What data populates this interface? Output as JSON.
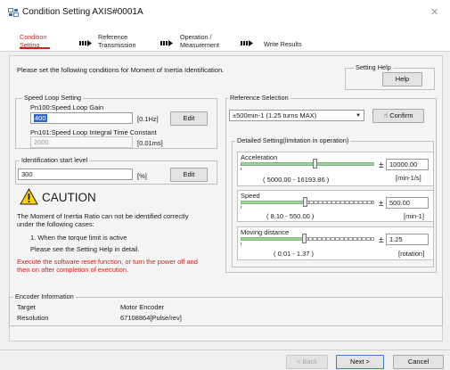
{
  "window": {
    "title": "Condition Setting AXIS#0001A",
    "icon": "app-window-icon",
    "close_icon": "close-icon"
  },
  "wizard": {
    "steps": [
      {
        "label": "Condition\nSetting",
        "active": true
      },
      {
        "label": "Reference\nTransmission",
        "active": false
      },
      {
        "label": "Operation /\nMeasurement",
        "active": false
      },
      {
        "label": "Write Results",
        "active": false
      }
    ],
    "active_color": "#d0241b"
  },
  "instructions": "Please set the following conditions for Moment of Inertia Identification.",
  "setting_help": {
    "group_label": "Setting Help",
    "button": "Help"
  },
  "speed_loop": {
    "group_label": "Speed Loop Setting",
    "gain_label": "Pn100:Speed Loop Gain",
    "gain_value": "400",
    "gain_unit": "[0.1Hz]",
    "edit_label": "Edit",
    "integral_label": "Pn101:Speed Loop Integral Time Constant",
    "integral_value": "2000",
    "integral_unit": "[0.01ms]"
  },
  "identification": {
    "group_label": "Identification start level",
    "value": "300",
    "unit": "[%]",
    "edit_label": "Edit"
  },
  "caution": {
    "icon": "warning-icon",
    "title": "CAUTION",
    "line1": "The Moment of Inertia Ratio can not be identified correctly",
    "line2": "under the following cases:",
    "case1": "1. When the torque limit is active",
    "help_note": "Please see the Setting Help in detail.",
    "warning1": "Execute the software reset function, or turn the power off and",
    "warning2": "then on after completion of execution.",
    "warning_color": "#d0241b"
  },
  "reference": {
    "group_label": "Reference Selection",
    "selected": "±500min-1 (1.25 turns MAX)",
    "confirm_label": "Confirm",
    "confirm_icon": "pointer-hand-icon",
    "detailed_label": "Detailed Setting(limitation in operation)",
    "acceleration": {
      "label": "Acceleration",
      "pm": "±",
      "value": "10000.00",
      "range": "( 5000.00 - 16193.86 )",
      "unit": "[min-1/s]",
      "level": 0.55
    },
    "speed": {
      "label": "Speed",
      "pm": "±",
      "value": "500.00",
      "range": "( 8.10 - 550.00 )",
      "unit": "[min-1]",
      "level": 0.48
    },
    "distance": {
      "label": "Moving distance",
      "pm": "±",
      "value": "1.25",
      "range": "( 0.01 - 1.37 )",
      "unit": "[rotation]",
      "level": 0.47
    }
  },
  "encoder": {
    "group_label": "Encoder Information",
    "target_label": "Target",
    "target_value": "Motor Encoder",
    "resolution_label": "Resolution",
    "resolution_value": "67108864[Pulse/rev]"
  },
  "buttons": {
    "back": "< Back",
    "next": "Next >",
    "cancel": "Cancel"
  }
}
